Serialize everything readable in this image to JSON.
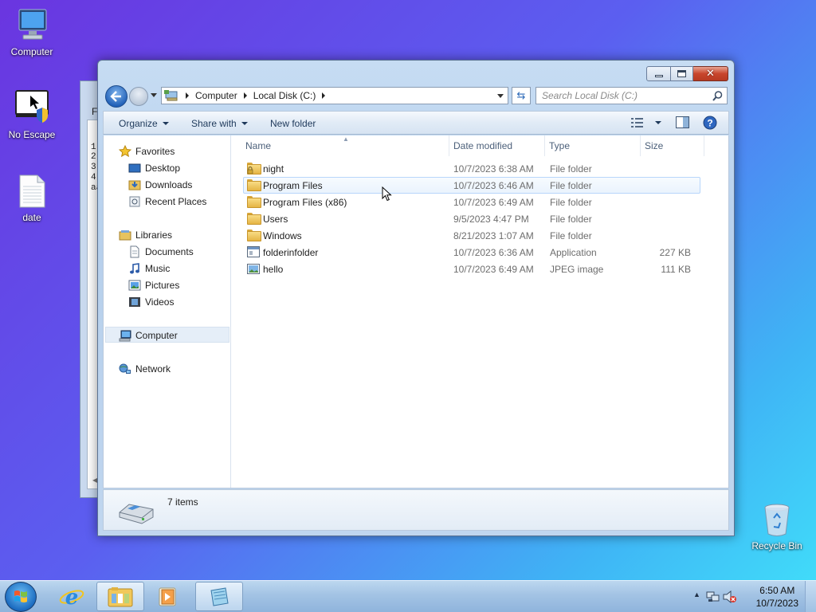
{
  "desktop": {
    "icons": [
      {
        "label": "Computer",
        "icon": "computer-icon"
      },
      {
        "label": "No Escape",
        "icon": "app-shortcut-icon"
      },
      {
        "label": "date",
        "icon": "text-file-icon"
      },
      {
        "label": "Recycle Bin",
        "icon": "recycle-bin-icon"
      }
    ]
  },
  "background_window": {
    "menu_initial": "F",
    "lines": [
      "1.",
      "2.",
      "3.",
      "4.",
      "aa"
    ]
  },
  "explorer": {
    "breadcrumb": [
      "Computer",
      "Local Disk (C:)"
    ],
    "search": {
      "placeholder": "Search Local Disk (C:)"
    },
    "toolbar": {
      "organize": "Organize",
      "share_with": "Share with",
      "new_folder": "New folder"
    },
    "nav_pane": {
      "favorites": "Favorites",
      "favorites_items": [
        "Desktop",
        "Downloads",
        "Recent Places"
      ],
      "libraries": "Libraries",
      "libraries_items": [
        "Documents",
        "Music",
        "Pictures",
        "Videos"
      ],
      "computer": "Computer",
      "network": "Network"
    },
    "columns": {
      "name": "Name",
      "date": "Date modified",
      "type": "Type",
      "size": "Size"
    },
    "files": [
      {
        "name": "night",
        "date": "10/7/2023 6:38 AM",
        "type": "File folder",
        "size": "",
        "icon": "locked-folder-icon"
      },
      {
        "name": "Program Files",
        "date": "10/7/2023 6:46 AM",
        "type": "File folder",
        "size": "",
        "icon": "folder-icon"
      },
      {
        "name": "Program Files (x86)",
        "date": "10/7/2023 6:49 AM",
        "type": "File folder",
        "size": "",
        "icon": "folder-icon"
      },
      {
        "name": "Users",
        "date": "9/5/2023 4:47 PM",
        "type": "File folder",
        "size": "",
        "icon": "folder-icon"
      },
      {
        "name": "Windows",
        "date": "8/21/2023 1:07 AM",
        "type": "File folder",
        "size": "",
        "icon": "folder-icon"
      },
      {
        "name": "folderinfolder",
        "date": "10/7/2023 6:36 AM",
        "type": "Application",
        "size": "227 KB",
        "icon": "application-icon"
      },
      {
        "name": "hello",
        "date": "10/7/2023 6:49 AM",
        "type": "JPEG image",
        "size": "111 KB",
        "icon": "image-icon"
      }
    ],
    "status": {
      "item_count": "7 items"
    }
  },
  "taskbar": {
    "clock_time": "6:50 AM",
    "clock_date": "10/7/2023"
  },
  "colors": {
    "accent": "#1f5fb7",
    "hover_row": "#b8d6fb"
  }
}
